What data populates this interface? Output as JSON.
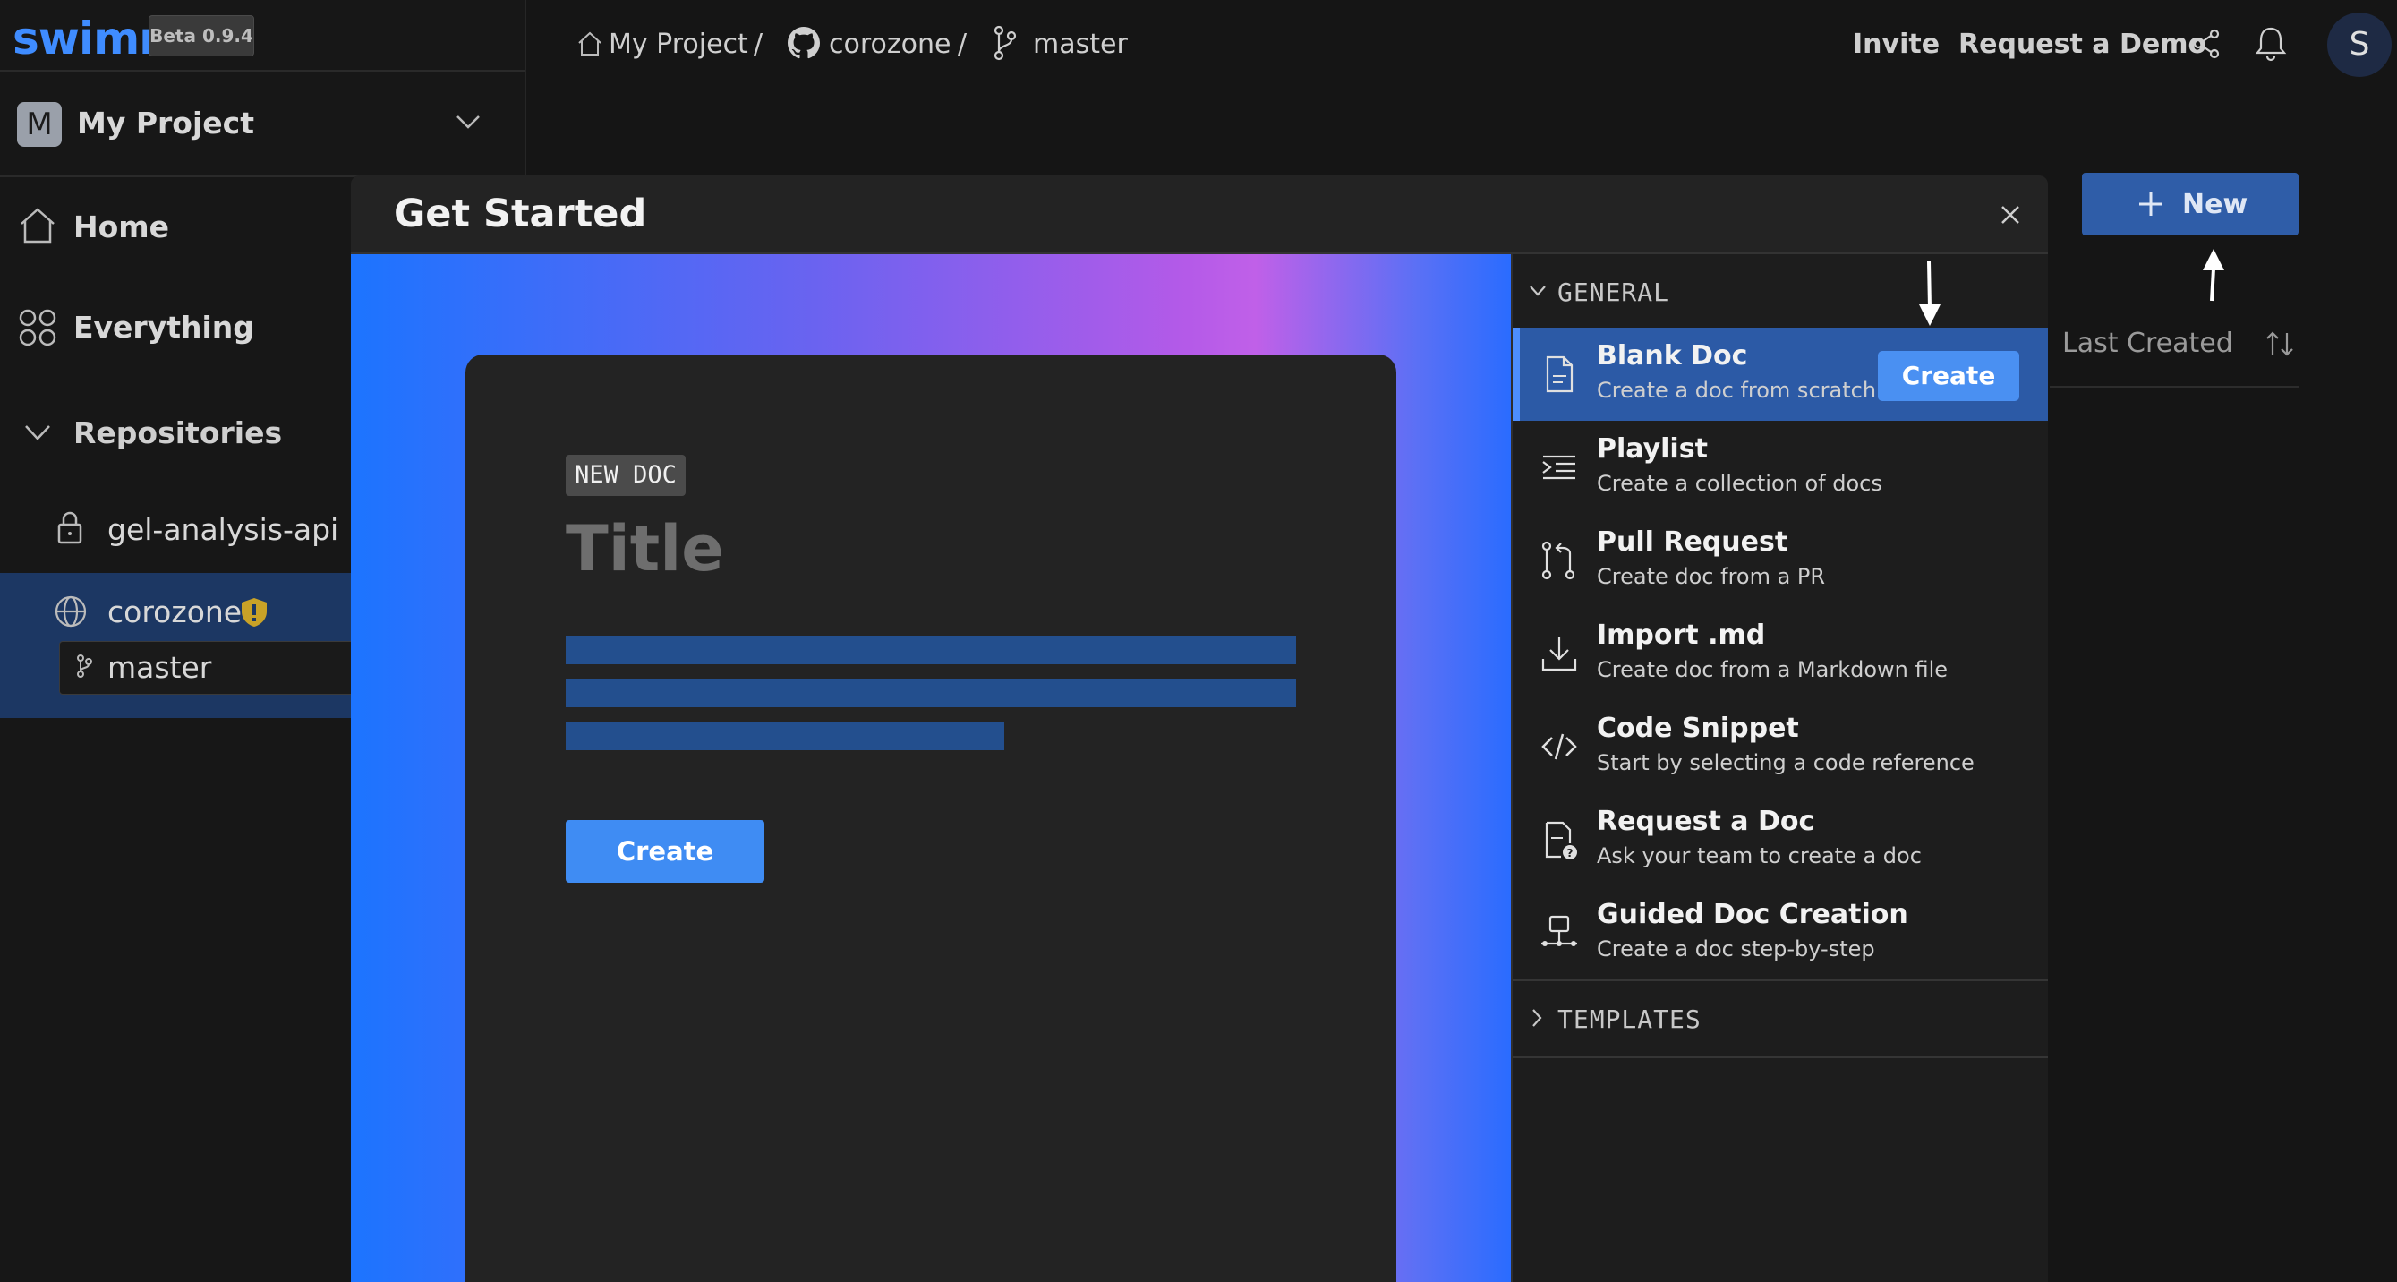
{
  "sidebar": {
    "logo": "swimm",
    "beta": "Beta 0.9.4",
    "project_initial": "M",
    "project_name": "My Project",
    "home": "Home",
    "everything": "Everything",
    "repositories": "Repositories",
    "repos": [
      {
        "name": "gel-analysis-api"
      },
      {
        "name": "corozone"
      }
    ],
    "branch": "master"
  },
  "topbar": {
    "breadcrumb": [
      "My Project",
      "/",
      "corozone",
      "/",
      "master"
    ],
    "invite": "Invite",
    "request_demo": "Request a Demo",
    "user_initial": "S"
  },
  "main": {
    "new_button": "New",
    "sort_label": "Last Created"
  },
  "modal": {
    "title": "Get Started",
    "preview": {
      "badge": "NEW DOC",
      "title": "Title",
      "create": "Create"
    },
    "general_header": "GENERAL",
    "templates_header": "TEMPLATES",
    "options": [
      {
        "title": "Blank Doc",
        "subtitle": "Create a doc from scratch",
        "icon": "doc-icon",
        "create": "Create"
      },
      {
        "title": "Playlist",
        "subtitle": "Create a collection of docs",
        "icon": "playlist-icon"
      },
      {
        "title": "Pull Request",
        "subtitle": "Create doc from a PR",
        "icon": "pull-request-icon"
      },
      {
        "title": "Import .md",
        "subtitle": "Create doc from a Markdown file",
        "icon": "download-icon"
      },
      {
        "title": "Code Snippet",
        "subtitle": "Start by selecting a code reference",
        "icon": "code-icon"
      },
      {
        "title": "Request a Doc",
        "subtitle": "Ask your team to create a doc",
        "icon": "request-doc-icon"
      },
      {
        "title": "Guided Doc Creation",
        "subtitle": "Create a doc step-by-step",
        "icon": "guided-icon"
      }
    ]
  },
  "colors": {
    "accent": "#3f8cff",
    "selected_option": "#2c5aa6",
    "selected_repo": "#1c3763",
    "badge_shield": "#c9a227"
  }
}
